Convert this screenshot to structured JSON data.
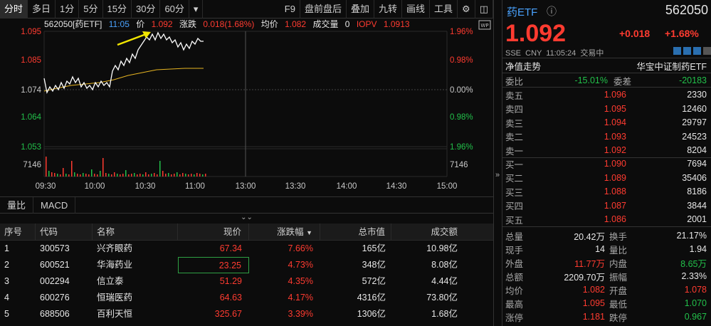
{
  "toolbar": {
    "items": [
      "分时",
      "多日",
      "1分",
      "5分",
      "15分",
      "30分",
      "60分",
      "▾"
    ],
    "right_items": [
      "F9",
      "盘前盘后",
      "叠加",
      "九转",
      "画线",
      "工具"
    ]
  },
  "chart": {
    "code_name": "562050[药ETF]",
    "time": "11:05",
    "price_label": "价",
    "price": "1.092",
    "change_label": "涨跌",
    "change": "0.018(1.68%)",
    "avg_label": "均价",
    "avg": "1.082",
    "volume_label": "成交量",
    "volume": "0",
    "iopv_label": "IOPV",
    "iopv": "1.0913",
    "y_left": [
      "1.095",
      "1.085",
      "1.074",
      "1.064",
      "1.053"
    ],
    "y_right": [
      "1.96%",
      "0.98%",
      "0.00%",
      "0.98%",
      "1.96%"
    ],
    "vol_tick": "7146",
    "x_ticks": [
      "09:30",
      "10:00",
      "10:30",
      "11:00",
      "13:00",
      "13:30",
      "14:00",
      "14:30",
      "15:00"
    ]
  },
  "subtabs": [
    "量比",
    "MACD"
  ],
  "table": {
    "headers": [
      "序号",
      "代码",
      "名称",
      "现价",
      "涨跌幅",
      "总市值",
      "成交额"
    ],
    "rows": [
      [
        "1",
        "300573",
        "兴齐眼药",
        "67.34",
        "7.66%",
        "165亿",
        "10.98亿"
      ],
      [
        "2",
        "600521",
        "华海药业",
        "23.25",
        "4.73%",
        "348亿",
        "8.08亿"
      ],
      [
        "3",
        "002294",
        "信立泰",
        "51.29",
        "4.35%",
        "572亿",
        "4.44亿"
      ],
      [
        "4",
        "600276",
        "恒瑞医药",
        "64.63",
        "4.17%",
        "4316亿",
        "73.80亿"
      ],
      [
        "5",
        "688506",
        "百利天恒",
        "325.67",
        "3.39%",
        "1306亿",
        "1.68亿"
      ]
    ]
  },
  "quote": {
    "name": "药ETF",
    "info_icon": "ⓘ",
    "code": "562050",
    "price": "1.092",
    "change": "+0.018",
    "change_pct": "+1.68%",
    "meta": "SSE  CNY  11:05:24  交易中",
    "nav_label": "净值走势",
    "fund_name": "华宝中证制药ETF",
    "weibi_label": "委比",
    "weibi": "-15.01%",
    "weicha_label": "委差",
    "weicha": "-20183"
  },
  "asks": [
    {
      "label": "卖五",
      "price": "1.096",
      "vol": "2330"
    },
    {
      "label": "卖四",
      "price": "1.095",
      "vol": "12460"
    },
    {
      "label": "卖三",
      "price": "1.094",
      "vol": "29797"
    },
    {
      "label": "卖二",
      "price": "1.093",
      "vol": "24523"
    },
    {
      "label": "卖一",
      "price": "1.092",
      "vol": "8204"
    }
  ],
  "bids": [
    {
      "label": "买一",
      "price": "1.090",
      "vol": "7694"
    },
    {
      "label": "买二",
      "price": "1.089",
      "vol": "35406"
    },
    {
      "label": "买三",
      "price": "1.088",
      "vol": "8186"
    },
    {
      "label": "买四",
      "price": "1.087",
      "vol": "3844"
    },
    {
      "label": "买五",
      "price": "1.086",
      "vol": "2001"
    }
  ],
  "stats": [
    {
      "l1": "总量",
      "v1": "20.42万",
      "c1": "white",
      "l2": "换手",
      "v2": "21.17%",
      "c2": "white"
    },
    {
      "l1": "现手",
      "v1": "14",
      "c1": "white",
      "l2": "量比",
      "v2": "1.94",
      "c2": "white"
    },
    {
      "l1": "外盘",
      "v1": "11.77万",
      "c1": "red",
      "l2": "内盘",
      "v2": "8.65万",
      "c2": "green"
    },
    {
      "l1": "总额",
      "v1": "2209.70万",
      "c1": "white",
      "l2": "振幅",
      "v2": "2.33%",
      "c2": "white"
    },
    {
      "l1": "均价",
      "v1": "1.082",
      "c1": "red",
      "l2": "开盘",
      "v2": "1.078",
      "c2": "red"
    },
    {
      "l1": "最高",
      "v1": "1.095",
      "c1": "red",
      "l2": "最低",
      "v2": "1.070",
      "c2": "green"
    },
    {
      "l1": "涨停",
      "v1": "1.181",
      "c1": "red",
      "l2": "跌停",
      "v2": "0.967",
      "c2": "green"
    }
  ],
  "colors": {
    "up": "#ff3b30",
    "down": "#22c04a",
    "avg_line": "#e6b422",
    "price_line": "#ffffff"
  }
}
